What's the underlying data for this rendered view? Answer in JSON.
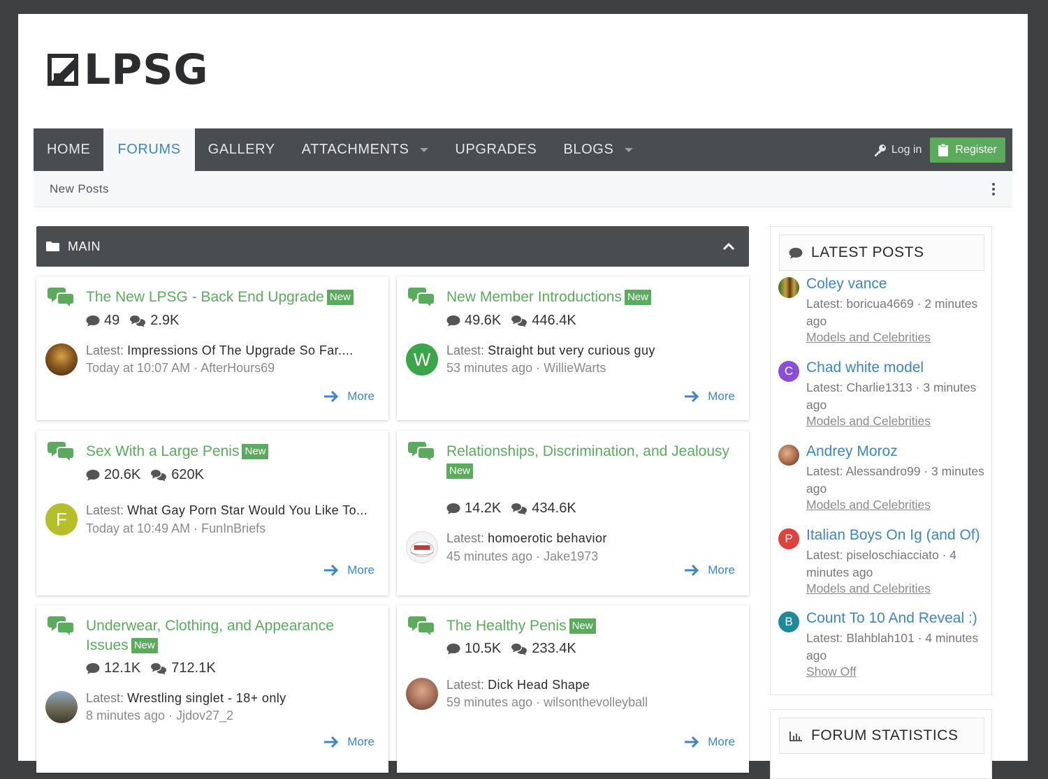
{
  "logo": {
    "text": "LPSG"
  },
  "nav": {
    "tabs": [
      {
        "label": "HOME"
      },
      {
        "label": "FORUMS"
      },
      {
        "label": "GALLERY"
      },
      {
        "label": "ATTACHMENTS"
      },
      {
        "label": "UPGRADES"
      },
      {
        "label": "BLOGS"
      }
    ],
    "login_label": "Log in",
    "register_label": "Register"
  },
  "subnav": {
    "new_posts": "New Posts"
  },
  "main": {
    "title": "MAIN"
  },
  "badge_new": "New",
  "latest_prefix": "Latest:",
  "more_label": "More",
  "forums": [
    {
      "title": "The New LPSG - Back End Upgrade",
      "threads": "49",
      "messages": "2.9K",
      "latest": "Impressions Of The Upgrade So Far....",
      "time": "Today at 10:07 AM",
      "user": "AfterHours69"
    },
    {
      "title": "New Member Introductions",
      "threads": "49.6K",
      "messages": "446.4K",
      "latest": "Straight but very curious guy",
      "time": "53 minutes ago",
      "user": "WillieWarts",
      "avatar_letter": "W"
    },
    {
      "title": "Sex With a Large Penis",
      "threads": "20.6K",
      "messages": "620K",
      "latest": "What Gay Porn Star Would You Like To...",
      "time": "Today at 10:49 AM",
      "user": "FunInBriefs",
      "avatar_letter": "F"
    },
    {
      "title": "Relationships, Discrimination, and Jealousy",
      "threads": "14.2K",
      "messages": "434.6K",
      "latest": "homoerotic behavior",
      "time": "45 minutes ago",
      "user": "Jake1973"
    },
    {
      "title": "Underwear, Clothing, and Appearance Issues",
      "threads": "12.1K",
      "messages": "712.1K",
      "latest": "Wrestling singlet - 18+ only",
      "time": "8 minutes ago",
      "user": "Jjdov27_2"
    },
    {
      "title": "The Healthy Penis",
      "threads": "10.5K",
      "messages": "233.4K",
      "latest": "Dick Head Shape",
      "time": "59 minutes ago",
      "user": "wilsonthevolleyball"
    }
  ],
  "sidebar": {
    "latest_posts_title": "LATEST POSTS",
    "forum_statistics_title": "FORUM STATISTICS",
    "posts": [
      {
        "title": "Coley vance",
        "user": "boricua4669",
        "time": "2 minutes ago",
        "forum": "Models and Celebrities"
      },
      {
        "title": "Chad white model",
        "user": "Charlie1313",
        "time": "3 minutes ago",
        "forum": "Models and Celebrities",
        "avatar_letter": "C"
      },
      {
        "title": "Andrey Moroz",
        "user": "Alessandro99",
        "time": "3 minutes ago",
        "forum": "Models and Celebrities"
      },
      {
        "title": "Italian Boys On Ig (and Of)",
        "user": "piseloschiacciato",
        "time": "4 minutes ago",
        "forum": "Models and Celebrities",
        "avatar_letter": "P"
      },
      {
        "title": "Count To 10 And Reveal :)",
        "user": "Blahblah101",
        "time": "4 minutes ago",
        "forum": "Show Off",
        "avatar_letter": "B"
      }
    ]
  },
  "colors": {
    "accent_green": "#5aac5c",
    "link_blue": "#3b86c4",
    "nav_dark": "#4a4d50"
  }
}
